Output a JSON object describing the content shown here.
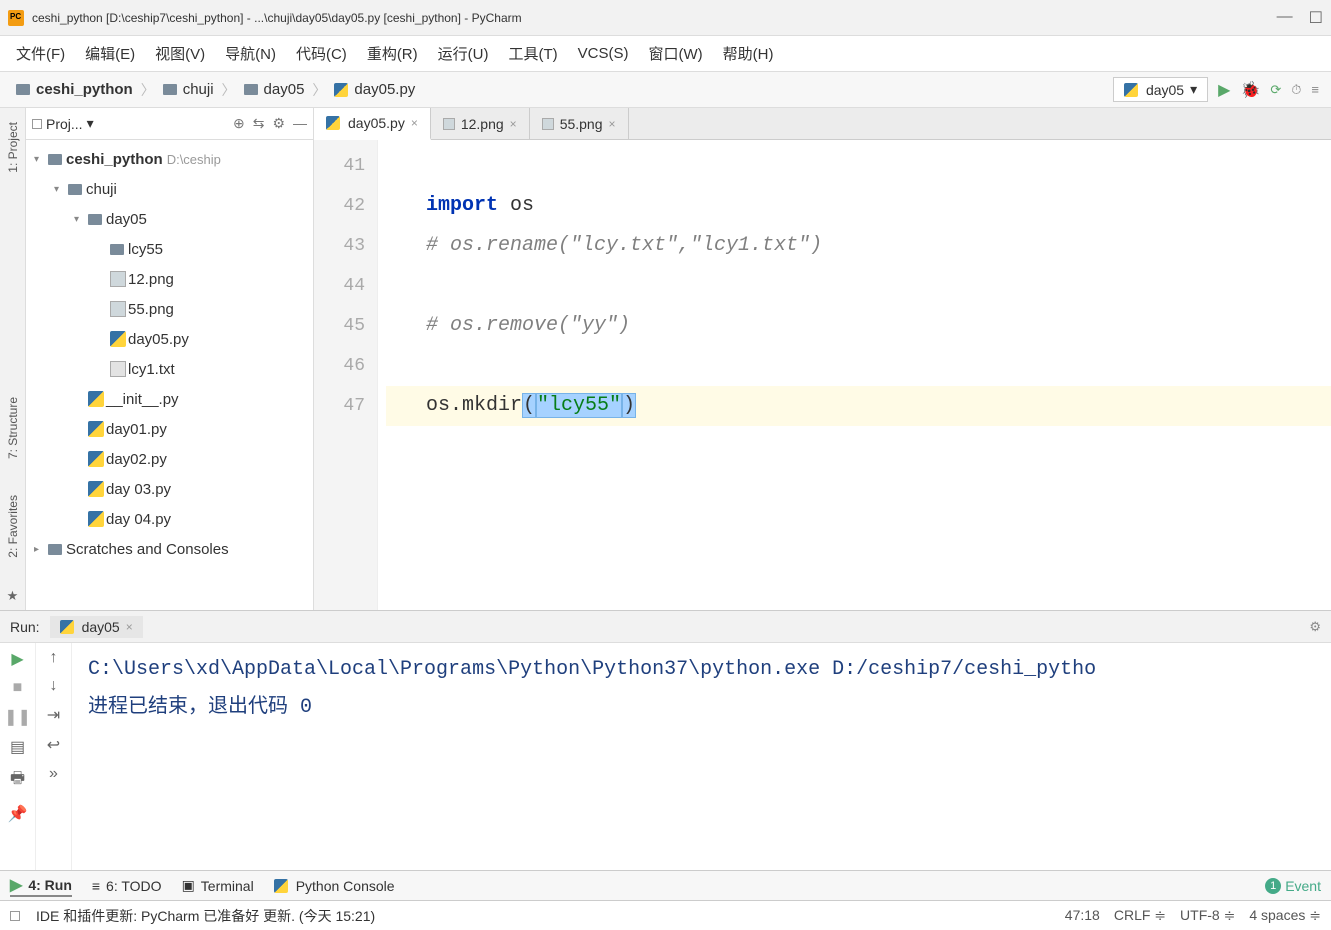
{
  "window": {
    "title": "ceshi_python [D:\\ceship7\\ceshi_python] - ...\\chuji\\day05\\day05.py [ceshi_python] - PyCharm"
  },
  "menu": {
    "file": "文件(F)",
    "edit": "编辑(E)",
    "view": "视图(V)",
    "navigate": "导航(N)",
    "code": "代码(C)",
    "refactor": "重构(R)",
    "run": "运行(U)",
    "tools": "工具(T)",
    "vcs": "VCS(S)",
    "window": "窗口(W)",
    "help": "帮助(H)"
  },
  "breadcrumb": {
    "root": "ceshi_python",
    "pkg": "chuji",
    "folder": "day05",
    "file": "day05.py"
  },
  "run_config": {
    "name": "day05"
  },
  "sidebar": {
    "project": "1: Project",
    "structure": "7: Structure",
    "favorites": "2: Favorites"
  },
  "project_panel": {
    "title": "Proj...",
    "root": "ceshi_python",
    "root_path": "D:\\ceship",
    "nodes": {
      "chuji": "chuji",
      "day05": "day05",
      "lcy55": "lcy55",
      "img12": "12.png",
      "img55": "55.png",
      "day05py": "day05.py",
      "lcy1": "lcy1.txt"
    },
    "init": "__init__.py",
    "day01": "day01.py",
    "day02": "day02.py",
    "day03": "day 03.py",
    "day04": "day 04.py",
    "scratches": "Scratches and Consoles"
  },
  "tabs": {
    "t1": "day05.py",
    "t2": "12.png",
    "t3": "55.png"
  },
  "code": {
    "l41": "",
    "l42_kw": "import",
    "l42_rest": " os",
    "l43": "# os.rename(\"lcy.txt\",\"lcy1.txt\")",
    "l44": "",
    "l45": "# os.remove(\"yy\")",
    "l46": "",
    "l47_a": "os.mkdir",
    "l47_p1": "(",
    "l47_str": "\"lcy55\"",
    "l47_p2": ")"
  },
  "gutter": {
    "n41": "41",
    "n42": "42",
    "n43": "43",
    "n44": "44",
    "n45": "45",
    "n46": "46",
    "n47": "47"
  },
  "run_panel": {
    "title": "Run:",
    "tab": "day05",
    "line1": "C:\\Users\\xd\\AppData\\Local\\Programs\\Python\\Python37\\python.exe D:/ceship7/ceshi_pytho",
    "line2": "",
    "line3": "进程已结束，退出代码 0"
  },
  "bottom_tabs": {
    "run": "4: Run",
    "todo": "6: TODO",
    "terminal": "Terminal",
    "pyconsole": "Python Console",
    "event": "Event"
  },
  "statusbar": {
    "msg": "IDE 和插件更新: PyCharm 已准备好 更新. (今天 15:21)",
    "pos": "47:18",
    "crlf": "CRLF",
    "enc": "UTF-8",
    "indent": "4 spaces"
  }
}
